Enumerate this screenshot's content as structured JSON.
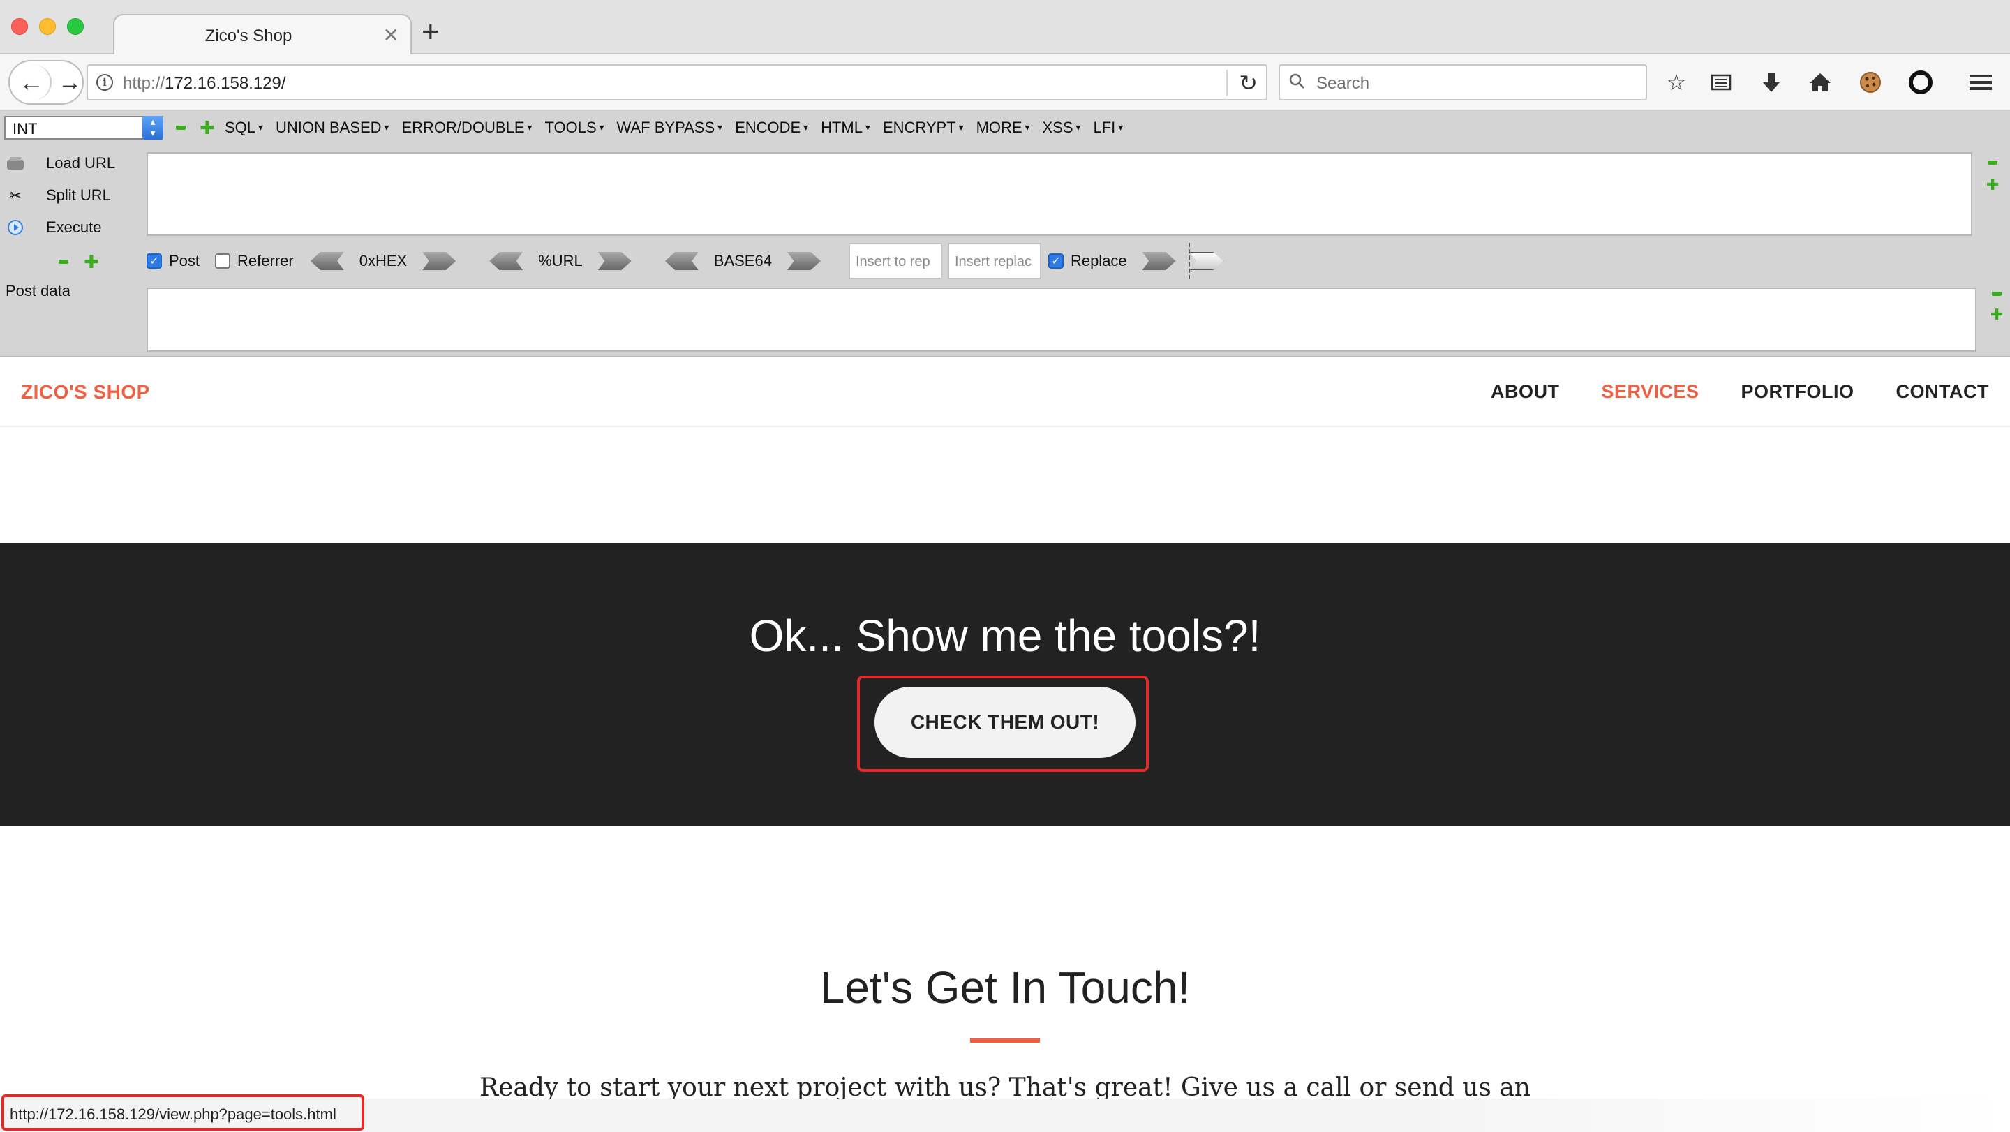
{
  "browser": {
    "tab_title": "Zico's Shop",
    "url_prefix": "http://",
    "url_host": "172.16.158.129/",
    "search_placeholder": "Search"
  },
  "hackbar": {
    "select_value": "INT",
    "menus": [
      "SQL",
      "UNION BASED",
      "ERROR/DOUBLE",
      "TOOLS",
      "WAF BYPASS",
      "ENCODE",
      "HTML",
      "ENCRYPT",
      "MORE",
      "XSS",
      "LFI"
    ],
    "load_url": "Load URL",
    "split_url": "Split URL",
    "execute": "Execute",
    "post_label": "Post",
    "referrer_label": "Referrer",
    "hex_label": "0xHEX",
    "urlenc_label": "%URL",
    "base64_label": "BASE64",
    "insert_to_replace": "Insert to rep",
    "insert_replacement": "Insert replac",
    "replace_label": "Replace",
    "post_data_label": "Post data",
    "post_checked": true,
    "referrer_checked": false,
    "replace_checked": true
  },
  "site": {
    "brand": "ZICO'S SHOP",
    "nav": [
      {
        "label": "ABOUT",
        "active": false
      },
      {
        "label": "SERVICES",
        "active": true
      },
      {
        "label": "PORTFOLIO",
        "active": false
      },
      {
        "label": "CONTACT",
        "active": false
      }
    ],
    "tools_heading": "Ok... Show me the tools?!",
    "tools_button": "CHECK THEM OUT!",
    "contact_heading": "Let's Get In Touch!",
    "contact_text": "Ready to start your next project with us? That's great! Give us a call or send us an email and we will get back to you as soon as possible!"
  },
  "status": {
    "link_url": "http://172.16.158.129/view.php?page=tools.html"
  },
  "colors": {
    "accent": "#f05f40",
    "dark_section": "#222222",
    "highlight": "#e02b2b"
  }
}
